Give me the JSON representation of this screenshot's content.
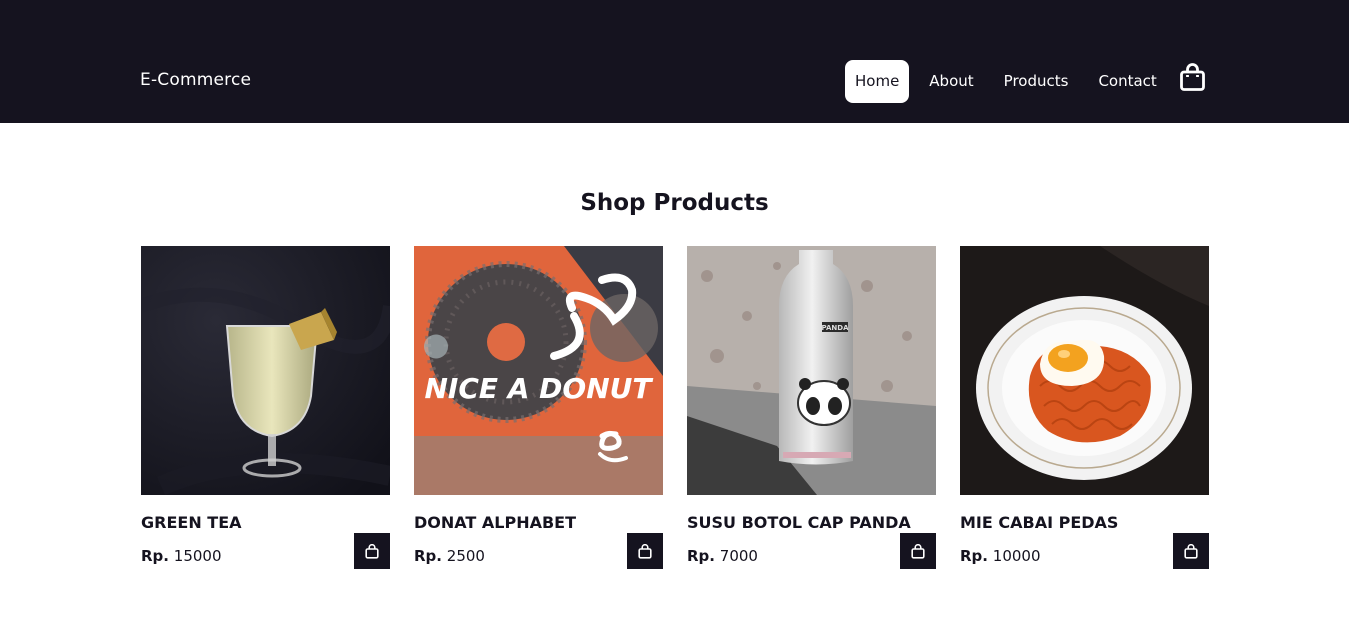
{
  "header": {
    "brand": "E-Commerce",
    "nav": [
      {
        "label": "Home",
        "active": true
      },
      {
        "label": "About",
        "active": false
      },
      {
        "label": "Products",
        "active": false
      },
      {
        "label": "Contact",
        "active": false
      }
    ],
    "cart_icon": "shopping-bag-icon"
  },
  "main": {
    "title": "Shop Products",
    "currency_prefix": "Rp.",
    "products": [
      {
        "name": "GREEN TEA",
        "price": "15000",
        "image": "green-tea-drink-photo"
      },
      {
        "name": "DONAT ALPHABET",
        "price": "2500",
        "image": "donut-photo",
        "image_text": "NICE A DONUT"
      },
      {
        "name": "SUSU BOTOL CAP PANDA",
        "price": "7000",
        "image": "panda-bottle-photo",
        "image_text": "PANDA"
      },
      {
        "name": "MIE CABAI PEDAS",
        "price": "10000",
        "image": "spicy-noodles-photo"
      }
    ]
  },
  "colors": {
    "navbar": "#15131f",
    "text": "#15131f",
    "background": "#ffffff"
  }
}
